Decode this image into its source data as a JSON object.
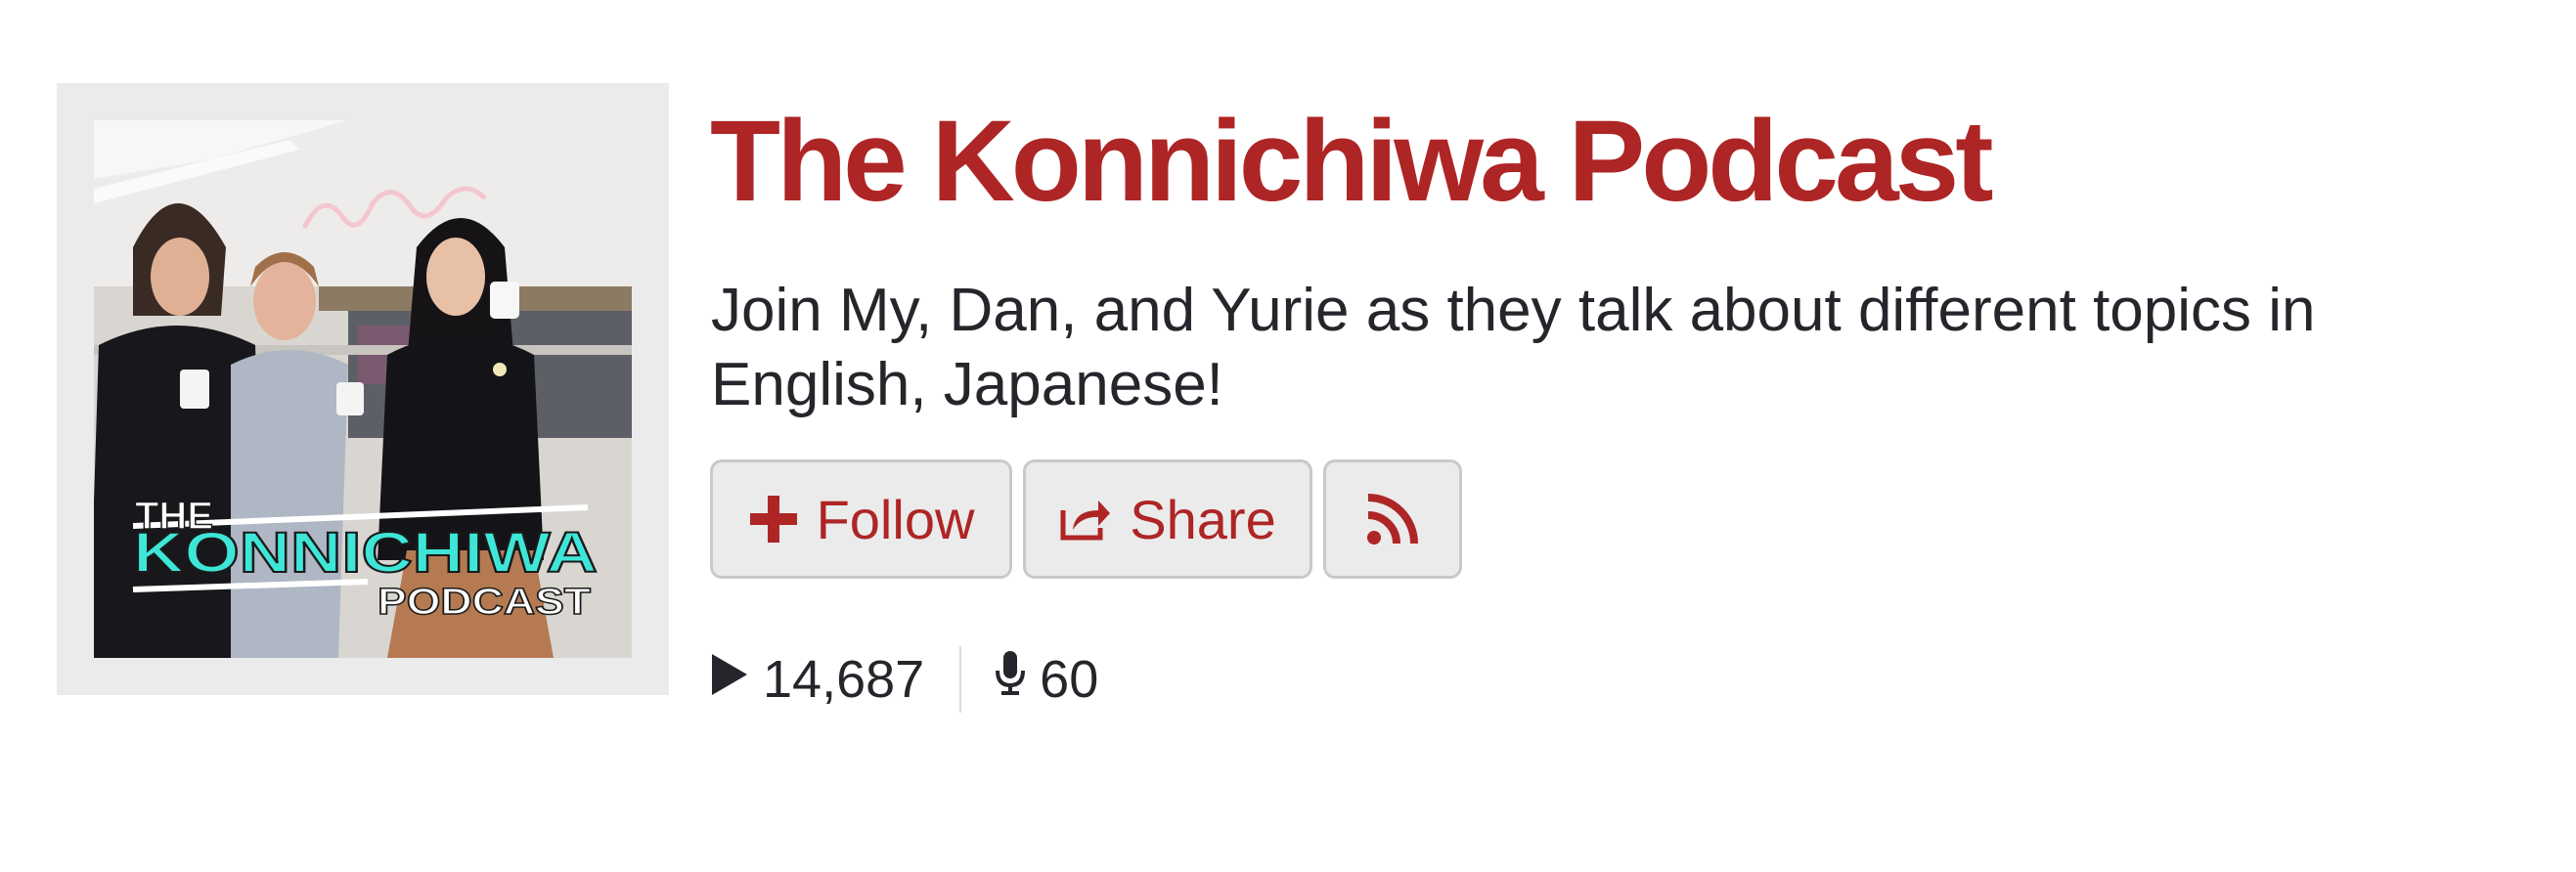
{
  "podcast": {
    "title": "The Konnichiwa Podcast",
    "description": "Join My, Dan, and Yurie as they talk about different topics in English, Japanese!",
    "cover": {
      "logo_line1": "THE",
      "logo_line2": "KONNICHIWA",
      "logo_line3": "PODCAST"
    }
  },
  "actions": {
    "follow_label": "Follow",
    "follow_icon": "plus-icon",
    "share_label": "Share",
    "share_icon": "share-icon",
    "rss_icon": "rss-icon"
  },
  "stats": {
    "plays": "14,687",
    "plays_icon": "play-icon",
    "episodes": "60",
    "episodes_icon": "microphone-icon"
  },
  "colors": {
    "accent": "#ae2525",
    "text": "#25262b",
    "button_bg": "#ebebeb",
    "button_border": "#c9c9c9",
    "logo_cyan": "#3ee6d8"
  }
}
